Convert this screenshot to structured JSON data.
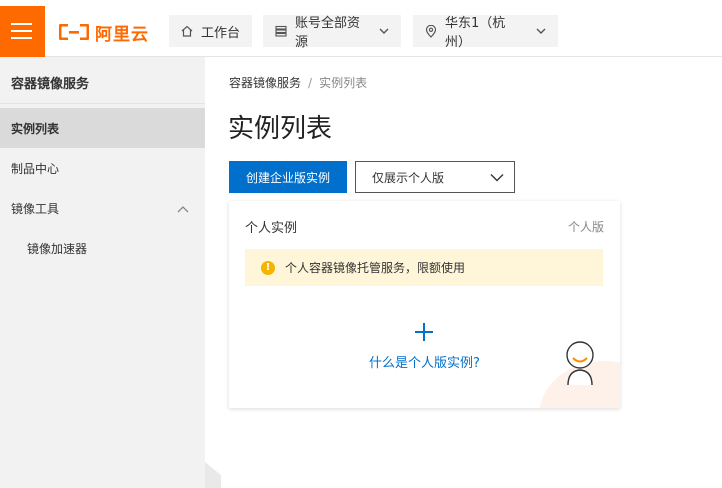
{
  "topbar": {
    "logo_text": "阿里云",
    "workbench_label": "工作台",
    "resources_label": "账号全部资源",
    "region_label": "华东1（杭州）",
    "icons": [
      "menu-icon",
      "home-icon",
      "list-icon",
      "location-icon",
      "chevron-down-icon"
    ]
  },
  "sidebar": {
    "title": "容器镜像服务",
    "items": [
      {
        "label": "实例列表",
        "active": true
      },
      {
        "label": "制品中心",
        "active": false
      },
      {
        "label": "镜像工具",
        "active": false,
        "expanded": true
      },
      {
        "label": "镜像加速器",
        "active": false,
        "sub": true
      }
    ]
  },
  "main": {
    "breadcrumb": [
      "容器镜像服务",
      "实例列表"
    ],
    "breadcrumb_sep": "/",
    "title": "实例列表",
    "create_button": "创建企业版实例",
    "filter_select": "仅展示个人版",
    "card": {
      "title": "个人实例",
      "tag": "个人版",
      "notice": "个人容器镜像托管服务，限额使用",
      "link": "什么是个人版实例?"
    }
  },
  "colors": {
    "brand": "#ff6a00",
    "primary": "#0070cc",
    "notice_bg": "#fff6da",
    "warn": "#f5b400"
  }
}
